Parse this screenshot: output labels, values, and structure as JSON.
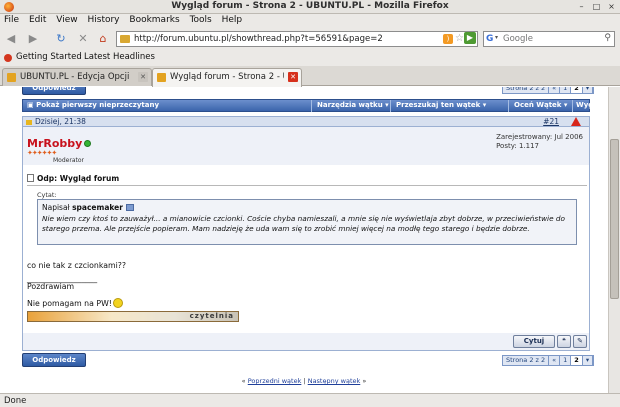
{
  "window": {
    "title": "Wygląd forum - Strona 2 - UBUNTU.PL - Mozilla Firefox",
    "controls": [
      "–",
      "□",
      "×"
    ]
  },
  "menu": {
    "items": [
      {
        "label": "File"
      },
      {
        "label": "Edit"
      },
      {
        "label": "View"
      },
      {
        "label": "History"
      },
      {
        "label": "Bookmarks"
      },
      {
        "label": "Tools"
      },
      {
        "label": "Help"
      }
    ]
  },
  "nav": {
    "back": "◀",
    "forward": "▶",
    "reload": "↻",
    "stop": "✕",
    "home": "⌂",
    "url": "http://forum.ubuntu.pl/showthread.php?t=56591&page=2",
    "search_placeholder": "Google",
    "search_engine_letter": "G"
  },
  "bookmarks": {
    "items": [
      {
        "label": "Getting Started"
      },
      {
        "label": "Latest Headlines"
      }
    ]
  },
  "tabs": [
    {
      "label": "UBUNTU.PL - Edycja Opcji",
      "active": false
    },
    {
      "label": "Wygląd forum - Strona 2 - UBU...",
      "active": true
    }
  ],
  "forum": {
    "reply_button": "Odpowiedz",
    "pager": {
      "label": "Strona 2 z 2",
      "prev": "«",
      "pages": [
        "1",
        "2"
      ],
      "current": "2"
    },
    "toolbar": {
      "first_unread": "Pokaż pierwszy nieprzeczytany",
      "thread_tools": "Narzędzia wątku",
      "search_thread": "Przeszukaj ten wątek",
      "rate_thread": "Oceń Wątek",
      "display": "Wygląd"
    },
    "post": {
      "date": "Dzisiej, 21:38",
      "number": "#21",
      "username": "MrRobby",
      "stars": "✦✦✦✦✦✦",
      "role": "Moderator",
      "registered": "Zarejestrowany: Jul 2006",
      "posts": "Posty: 1.117",
      "title": "Odp: Wygląd forum",
      "quote_label": "Cytat:",
      "quote_author_prefix": "Napisał",
      "quote_author": "spacemaker",
      "quote_text": "Nie wiem czy ktoś to zauważył... a mianowicie czcionki. Coście chyba namieszali, a mnie się nie wyświetlaja zbyt dobrze, w przeciwieństwie do starego przema. Ale przejście popieram. Mam nadzieję że uda wam się to zrobić mniej więcej na modłę tego starego i będzie dobrze.",
      "line1": "co nie tak z czcionkami??",
      "separator": "__________________",
      "greeting": "Pozdrawiam",
      "signature": "Nie pomagam na PW!",
      "banner_text": "czytelnia",
      "quote_button": "Cytuj"
    },
    "thread_nav": {
      "prev": "Poprzedni wątek",
      "sep": "|",
      "next": "Następny wątek",
      "left": "«",
      "right": "»"
    }
  },
  "status": {
    "text": "Done"
  }
}
